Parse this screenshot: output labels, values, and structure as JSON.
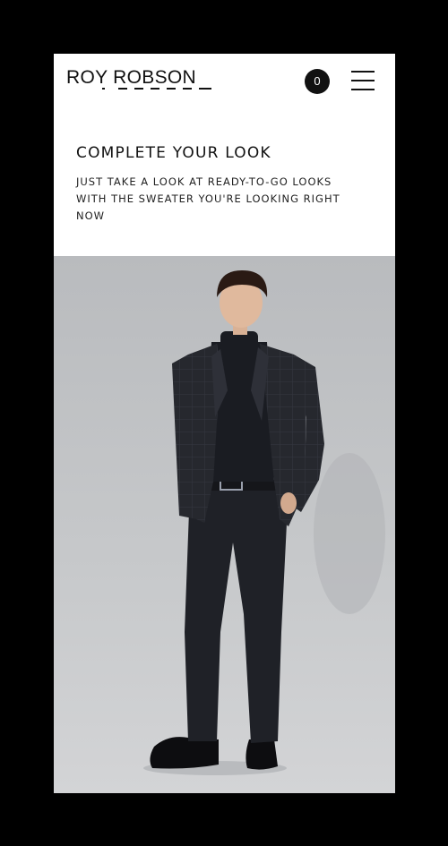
{
  "header": {
    "logo_text": "ROY ROBSON",
    "cart_count": "0",
    "menu_icon": "hamburger-menu-icon"
  },
  "section": {
    "title": "COMPLETE YOUR LOOK",
    "subtitle": "JUST TAKE A LOOK AT READY-TO-GO LOOKS WITH THE SWEATER YOU'RE LOOKING RIGHT NOW"
  },
  "colors": {
    "page_background": "#000000",
    "screen_background": "#ffffff",
    "text": "#111111",
    "photo_background": "#c6c8ca"
  }
}
